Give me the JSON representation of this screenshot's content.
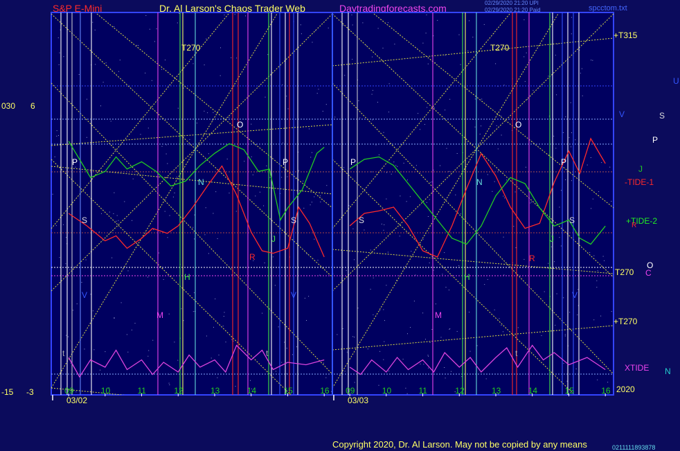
{
  "header": {
    "instrument": "S&P E-Mini",
    "author": "Dr. Al Larson's Chaos Trader Web",
    "site": "Daytradingforecasts.com",
    "timestamp1": "02/29/2020 21:20 UPI",
    "timestamp2": "02/29/2020 21:20 Paid",
    "file": "spcctom.txt"
  },
  "left_axis": {
    "top_a": "030",
    "top_b": "6",
    "bottom_a": "-15",
    "bottom_b": "-3"
  },
  "right_labels": {
    "t315": "+T315",
    "v": "V",
    "s": "S",
    "u": "U",
    "p": "P",
    "j": "J",
    "tide1": "-TIDE-1",
    "tide2": "+TIDE-2",
    "r": "R",
    "t270a": "T270",
    "o": "O",
    "c": "C",
    "t270b": "+T270",
    "xtide": "XTIDE",
    "n": "N",
    "year": "2020"
  },
  "copyright": "Copyright 2020, Dr. Al Larson. May not be copied by any means",
  "footer_code": "0211111893878",
  "chart_data": {
    "type": "line",
    "title": "S&P E-Mini",
    "days": [
      "03/02",
      "03/03"
    ],
    "hours": [
      "09",
      "10",
      "11",
      "12",
      "13",
      "14",
      "15",
      "16"
    ],
    "series": [
      {
        "name": "-TIDE-1",
        "color": "#ff2a2a",
        "day1": [
          [
            9.0,
            0.4
          ],
          [
            9.5,
            0.3
          ],
          [
            10.0,
            0.18
          ],
          [
            10.3,
            0.22
          ],
          [
            10.6,
            0.12
          ],
          [
            11.0,
            0.2
          ],
          [
            11.3,
            0.28
          ],
          [
            11.7,
            0.24
          ],
          [
            12.0,
            0.3
          ],
          [
            12.4,
            0.45
          ],
          [
            12.8,
            0.62
          ],
          [
            13.2,
            0.78
          ],
          [
            13.6,
            0.55
          ],
          [
            14.0,
            0.25
          ],
          [
            14.3,
            0.1
          ],
          [
            14.6,
            0.08
          ],
          [
            15.0,
            0.12
          ],
          [
            15.3,
            0.45
          ],
          [
            15.6,
            0.32
          ],
          [
            16.0,
            0.05
          ]
        ],
        "day2": [
          [
            9.0,
            0.3
          ],
          [
            9.4,
            0.4
          ],
          [
            9.8,
            0.42
          ],
          [
            10.2,
            0.45
          ],
          [
            10.6,
            0.3
          ],
          [
            11.0,
            0.1
          ],
          [
            11.4,
            0.05
          ],
          [
            11.8,
            0.3
          ],
          [
            12.2,
            0.6
          ],
          [
            12.6,
            0.88
          ],
          [
            13.0,
            0.7
          ],
          [
            13.4,
            0.45
          ],
          [
            13.8,
            0.28
          ],
          [
            14.2,
            0.32
          ],
          [
            14.6,
            0.65
          ],
          [
            15.0,
            0.9
          ],
          [
            15.3,
            0.72
          ],
          [
            15.6,
            1.0
          ],
          [
            16.0,
            0.8
          ]
        ]
      },
      {
        "name": "+TIDE-2",
        "color": "#22cc22",
        "day1": [
          [
            9.0,
            0.95
          ],
          [
            9.3,
            0.8
          ],
          [
            9.6,
            0.65
          ],
          [
            10.0,
            0.7
          ],
          [
            10.3,
            0.82
          ],
          [
            10.6,
            0.72
          ],
          [
            11.0,
            0.78
          ],
          [
            11.4,
            0.7
          ],
          [
            11.8,
            0.58
          ],
          [
            12.2,
            0.62
          ],
          [
            12.6,
            0.75
          ],
          [
            13.0,
            0.85
          ],
          [
            13.4,
            0.93
          ],
          [
            13.8,
            0.88
          ],
          [
            14.2,
            0.7
          ],
          [
            14.5,
            0.72
          ],
          [
            14.8,
            0.3
          ],
          [
            15.0,
            0.4
          ],
          [
            15.4,
            0.55
          ],
          [
            15.8,
            0.85
          ],
          [
            16.0,
            0.9
          ]
        ],
        "day2": [
          [
            9.0,
            0.72
          ],
          [
            9.4,
            0.8
          ],
          [
            9.8,
            0.82
          ],
          [
            10.2,
            0.75
          ],
          [
            10.6,
            0.6
          ],
          [
            11.0,
            0.45
          ],
          [
            11.4,
            0.3
          ],
          [
            11.8,
            0.15
          ],
          [
            12.2,
            0.1
          ],
          [
            12.6,
            0.25
          ],
          [
            13.0,
            0.5
          ],
          [
            13.4,
            0.65
          ],
          [
            13.8,
            0.6
          ],
          [
            14.2,
            0.4
          ],
          [
            14.6,
            0.25
          ],
          [
            15.0,
            0.3
          ],
          [
            15.3,
            0.15
          ],
          [
            15.6,
            0.1
          ],
          [
            16.0,
            0.25
          ]
        ]
      },
      {
        "name": "XTIDE",
        "color": "#dd44dd",
        "day1": [
          [
            9.0,
            0.6
          ],
          [
            9.3,
            0.2
          ],
          [
            9.6,
            0.55
          ],
          [
            10.0,
            0.4
          ],
          [
            10.3,
            0.75
          ],
          [
            10.6,
            0.35
          ],
          [
            11.0,
            0.55
          ],
          [
            11.3,
            0.25
          ],
          [
            11.6,
            0.5
          ],
          [
            12.0,
            0.3
          ],
          [
            12.3,
            0.65
          ],
          [
            12.6,
            0.4
          ],
          [
            13.0,
            0.55
          ],
          [
            13.3,
            0.3
          ],
          [
            13.6,
            0.85
          ],
          [
            14.0,
            0.55
          ],
          [
            14.3,
            0.75
          ],
          [
            14.6,
            0.35
          ],
          [
            15.0,
            0.5
          ],
          [
            15.5,
            0.45
          ],
          [
            16.0,
            0.55
          ]
        ],
        "day2": [
          [
            9.0,
            0.4
          ],
          [
            9.3,
            0.25
          ],
          [
            9.6,
            0.55
          ],
          [
            10.0,
            0.3
          ],
          [
            10.3,
            0.6
          ],
          [
            10.6,
            0.35
          ],
          [
            11.0,
            0.55
          ],
          [
            11.3,
            0.3
          ],
          [
            11.6,
            0.7
          ],
          [
            12.0,
            0.4
          ],
          [
            12.3,
            0.6
          ],
          [
            12.6,
            0.3
          ],
          [
            13.0,
            0.6
          ],
          [
            13.3,
            0.8
          ],
          [
            13.6,
            0.4
          ],
          [
            14.0,
            0.85
          ],
          [
            14.3,
            0.55
          ],
          [
            14.6,
            0.7
          ],
          [
            15.0,
            0.45
          ],
          [
            15.5,
            0.6
          ],
          [
            16.0,
            0.35
          ]
        ]
      }
    ],
    "vertical_markers": [
      "T270",
      "O",
      "P",
      "S",
      "N",
      "H",
      "J",
      "R",
      "M",
      "V",
      "t"
    ],
    "grid": true,
    "legend_placement": "right"
  }
}
